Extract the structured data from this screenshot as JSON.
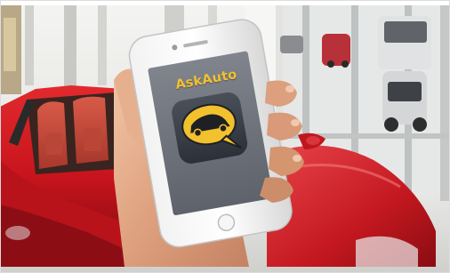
{
  "photo": {
    "subject": "hand-holding-phone-in-car-showroom",
    "app_screen": {
      "app_name": "AskAuto",
      "icon": "car-speech-bubble-icon",
      "accent_color": "#f2c12e",
      "icon_background": "#3a3f48",
      "screen_color": "#6e727a"
    },
    "car_color": "#c8141c"
  }
}
